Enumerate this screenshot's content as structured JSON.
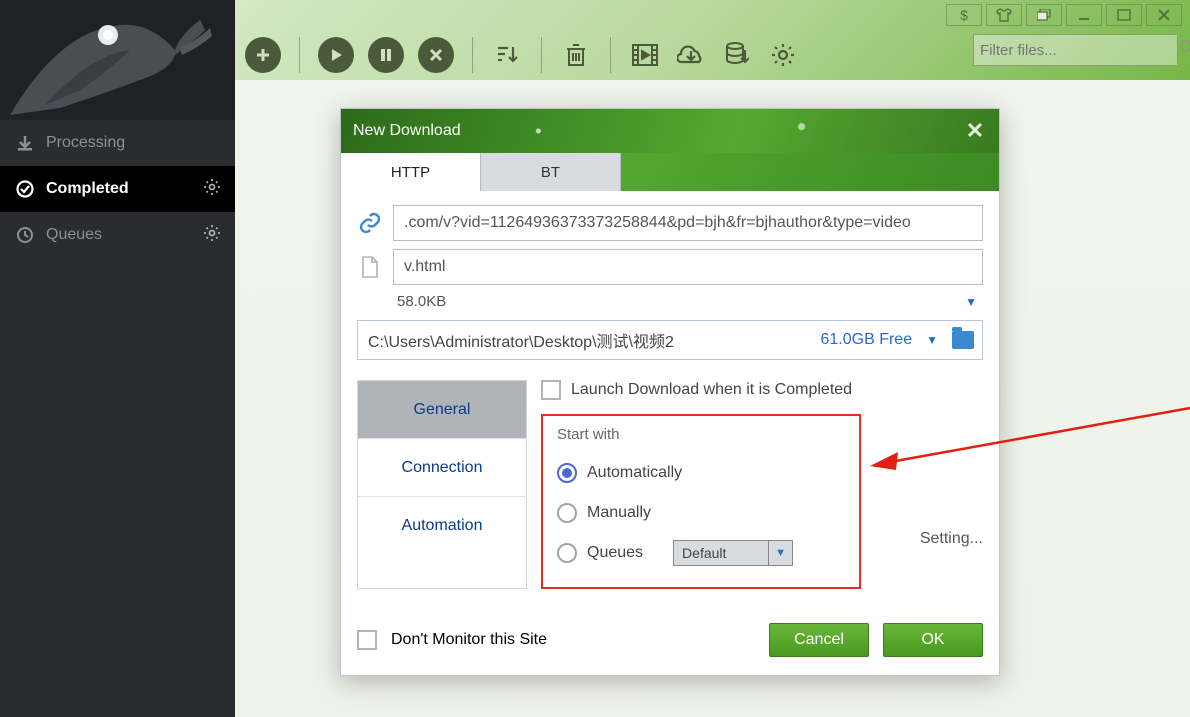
{
  "sidebar": {
    "items": [
      {
        "label": "Processing"
      },
      {
        "label": "Completed"
      },
      {
        "label": "Queues"
      }
    ]
  },
  "filter": {
    "placeholder": "Filter files..."
  },
  "dialog": {
    "title": "New Download",
    "tabs": {
      "http": "HTTP",
      "bt": "BT"
    },
    "url": ".com/v?vid=11264936373373258844&pd=bjh&fr=bjhauthor&type=video",
    "filename": "v.html",
    "size": "58.0KB",
    "path": "C:\\Users\\Administrator\\Desktop\\测试\\视频2",
    "free": "61.0GB Free",
    "opt_tabs": {
      "general": "General",
      "connection": "Connection",
      "automation": "Automation"
    },
    "launch_label": "Launch Download when it is Completed",
    "start_with": {
      "title": "Start with",
      "auto": "Automatically",
      "manual": "Manually",
      "queues": "Queues",
      "queue_value": "Default"
    },
    "setting": "Setting...",
    "dont_monitor": "Don't Monitor this Site",
    "cancel": "Cancel",
    "ok": "OK"
  }
}
